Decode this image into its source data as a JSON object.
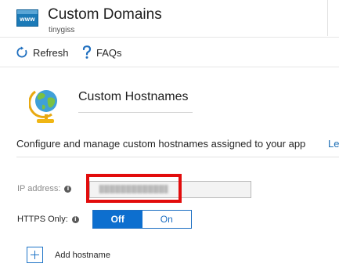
{
  "header": {
    "app_icon_text": "www",
    "title": "Custom Domains",
    "subtitle": "tinygiss"
  },
  "toolbar": {
    "refresh_label": "Refresh",
    "faqs_label": "FAQs",
    "icons": [
      "refresh-icon",
      "question-icon"
    ]
  },
  "section": {
    "title": "Custom Hostnames",
    "description": "Configure and manage custom hostnames assigned to your app",
    "link_text": "Le",
    "icon": "globe-icon"
  },
  "ip": {
    "label": "IP address:",
    "value_state": "redacted"
  },
  "https": {
    "label": "HTTPS Only:",
    "off_label": "Off",
    "on_label": "On",
    "selected": "Off"
  },
  "add": {
    "label": "Add hostname"
  },
  "colors": {
    "accent": "#0d6fcf",
    "highlight": "#e20c0c",
    "link": "#1e6fb5"
  }
}
